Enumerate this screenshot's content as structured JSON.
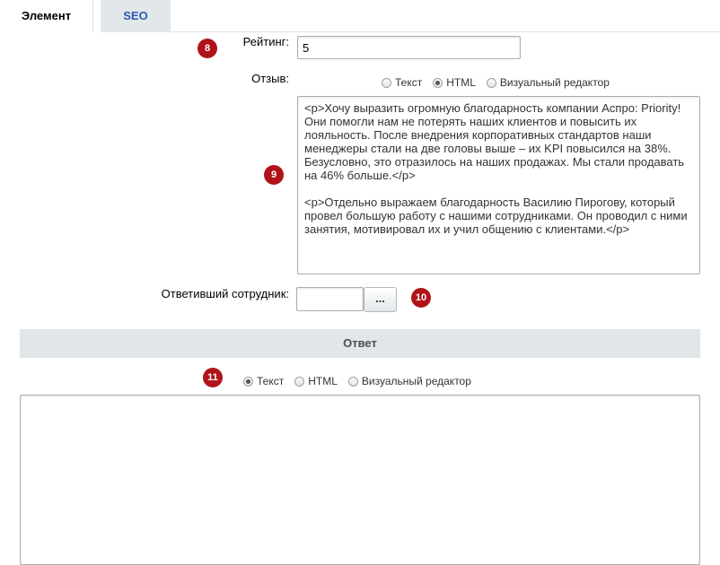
{
  "tabs": [
    {
      "label": "Элемент",
      "active": true
    },
    {
      "label": "SEO",
      "active": false
    }
  ],
  "badges": {
    "rating": "8",
    "review": "9",
    "employee": "10",
    "answer": "11"
  },
  "rating": {
    "label": "Рейтинг:",
    "value": "5"
  },
  "review": {
    "label": "Отзыв:",
    "modes": [
      {
        "label": "Текст",
        "checked": false
      },
      {
        "label": "HTML",
        "checked": true
      },
      {
        "label": "Визуальный редактор",
        "checked": false
      }
    ],
    "text": "<p>Хочу выразить огромную благодарность компании Аспро: Priority! Они помогли нам не потерять наших клиентов и повысить их лояльность. После внедрения корпоративных стандартов наши менеджеры стали на две головы выше – их KPI повысился на 38%. Безусловно, это отразилось на наших продажах. Мы стали продавать на 46% больше.</p>\n\n<p>Отдельно выражаем благодарность Василию Пирогову, который провел большую работу с нашими сотрудниками. Он проводил с ними занятия, мотивировал их и учил общению с клиентами.</p>"
  },
  "employee": {
    "label": "Ответивший сотрудник:",
    "value": "",
    "button_label": "..."
  },
  "answer": {
    "section_title": "Ответ",
    "modes": [
      {
        "label": "Текст",
        "checked": true
      },
      {
        "label": "HTML",
        "checked": false
      },
      {
        "label": "Визуальный редактор",
        "checked": false
      }
    ],
    "text": ""
  },
  "colors": {
    "badge": "#b0141a",
    "tab_inactive_text": "#2a5ab0",
    "section_bg": "#e1e6e8"
  }
}
